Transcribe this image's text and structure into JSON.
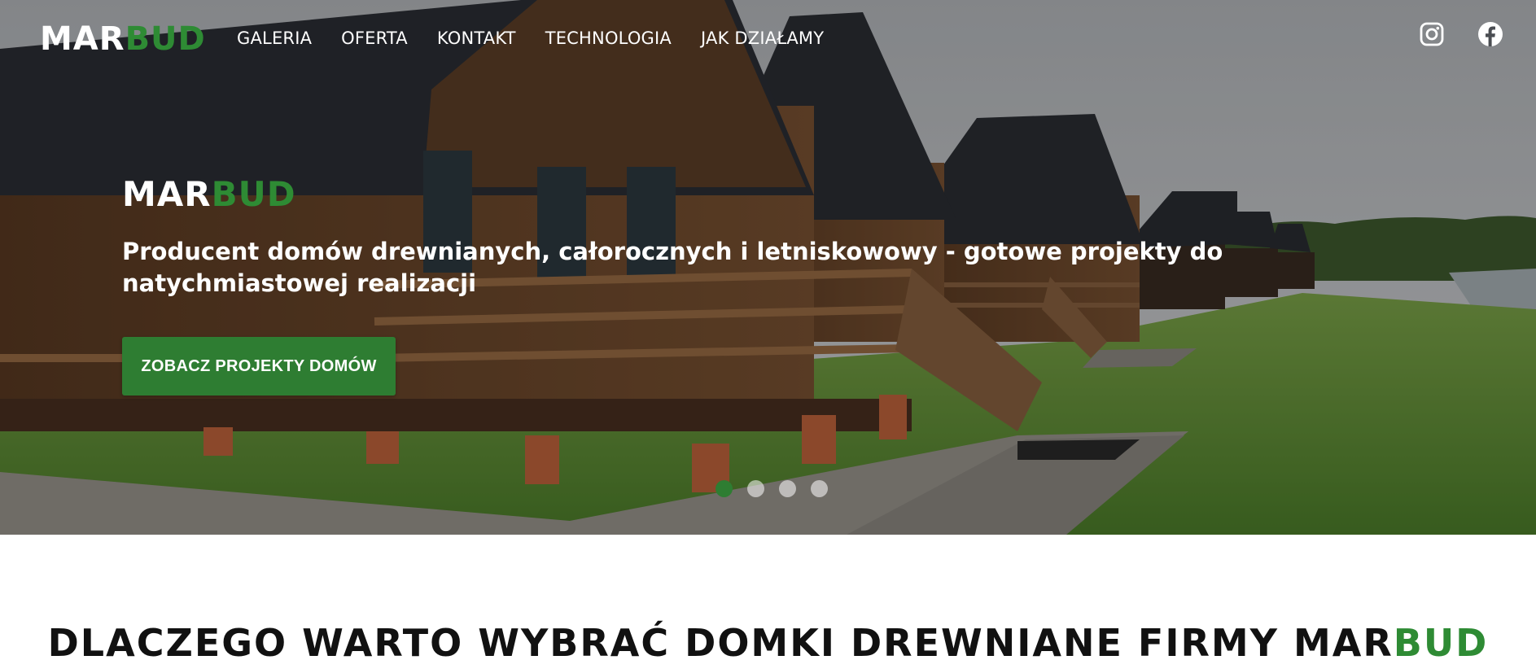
{
  "logo": {
    "part1": "MAR",
    "part2": "BUD"
  },
  "nav": {
    "items": [
      {
        "label": "GALERIA"
      },
      {
        "label": "OFERTA"
      },
      {
        "label": "KONTAKT"
      },
      {
        "label": "TECHNOLOGIA"
      },
      {
        "label": "JAK DZIAŁAMY"
      }
    ]
  },
  "social": {
    "instagram": "instagram-icon",
    "facebook": "facebook-icon"
  },
  "hero": {
    "brand_part1": "MAR",
    "brand_part2": "BUD",
    "subtitle": "Producent domów drewnianych, całorocznych i letniskowowy - gotowe projekty do natychmiastowej realizacji",
    "cta_label": "ZOBACZ PROJEKTY DOMÓW",
    "slides_total": 4,
    "active_slide": 1
  },
  "section": {
    "title_part1": "DLACZEGO WARTO WYBRAĆ DOMKI DREWNIANE FIRMY MAR",
    "title_part2": "BUD"
  },
  "colors": {
    "accent": "#2e7d32",
    "brand_green": "#2e8b34",
    "text_dark": "#111111"
  }
}
